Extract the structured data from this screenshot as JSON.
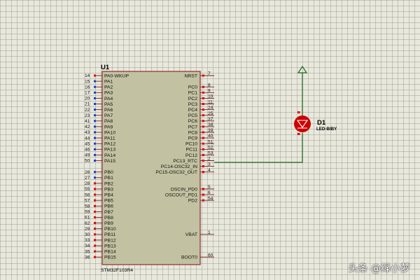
{
  "colors": {
    "chip_fill": "#c2c2a2",
    "chip_border": "#8b2e2e",
    "pin_line": "#7a2020",
    "wire": "#1e6a1e",
    "led_red": "#cc0000",
    "pin_dot_blue": "#1a3cc8",
    "pin_dot_red": "#e00000"
  },
  "chip": {
    "ref": "U1",
    "part": "STM32F103R4",
    "left_pins": [
      {
        "num": "14",
        "label": "PA0-WKUP"
      },
      {
        "num": "15",
        "label": "PA1"
      },
      {
        "num": "16",
        "label": "PA2"
      },
      {
        "num": "17",
        "label": "PA3"
      },
      {
        "num": "20",
        "label": "PA4"
      },
      {
        "num": "21",
        "label": "PA5"
      },
      {
        "num": "22",
        "label": "PA6"
      },
      {
        "num": "23",
        "label": "PA7"
      },
      {
        "num": "41",
        "label": "PA8"
      },
      {
        "num": "42",
        "label": "PA9"
      },
      {
        "num": "43",
        "label": "PA10"
      },
      {
        "num": "44",
        "label": "PA11"
      },
      {
        "num": "45",
        "label": "PA12"
      },
      {
        "num": "46",
        "label": "PA13"
      },
      {
        "num": "49",
        "label": "PA14"
      },
      {
        "num": "50",
        "label": "PA15"
      },
      {
        "num": "26",
        "label": "PB0"
      },
      {
        "num": "27",
        "label": "PB1"
      },
      {
        "num": "28",
        "label": "PB2"
      },
      {
        "num": "55",
        "label": "PB3"
      },
      {
        "num": "56",
        "label": "PB4"
      },
      {
        "num": "57",
        "label": "PB5"
      },
      {
        "num": "58",
        "label": "PB6"
      },
      {
        "num": "59",
        "label": "PB7"
      },
      {
        "num": "61",
        "label": "PB8"
      },
      {
        "num": "62",
        "label": "PB9"
      },
      {
        "num": "29",
        "label": "PB10"
      },
      {
        "num": "30",
        "label": "PB11"
      },
      {
        "num": "33",
        "label": "PB12"
      },
      {
        "num": "34",
        "label": "PB13"
      },
      {
        "num": "35",
        "label": "PB14"
      },
      {
        "num": "36",
        "label": "PB15"
      }
    ],
    "right_pins": [
      {
        "num": "7",
        "label": "NRST"
      },
      {
        "num": "8",
        "label": "PC0"
      },
      {
        "num": "9",
        "label": "PC1"
      },
      {
        "num": "10",
        "label": "PC2"
      },
      {
        "num": "11",
        "label": "PC3"
      },
      {
        "num": "24",
        "label": "PC4"
      },
      {
        "num": "25",
        "label": "PC5"
      },
      {
        "num": "37",
        "label": "PC6"
      },
      {
        "num": "38",
        "label": "PC7"
      },
      {
        "num": "39",
        "label": "PC8"
      },
      {
        "num": "40",
        "label": "PC9"
      },
      {
        "num": "51",
        "label": "PC10"
      },
      {
        "num": "52",
        "label": "PC11"
      },
      {
        "num": "53",
        "label": "PC12"
      },
      {
        "num": "2",
        "label": "PC13_RTC"
      },
      {
        "num": "3",
        "label": "PC14-OSC32_IN"
      },
      {
        "num": "4",
        "label": "PC15-OSC32_OUT"
      },
      {
        "num": "5",
        "label": "OSCIN_PD0"
      },
      {
        "num": "6",
        "label": "OSCOUT_PD1"
      },
      {
        "num": "54",
        "label": "PD2"
      },
      {
        "num": "1",
        "label": "VBAT"
      },
      {
        "num": "60",
        "label": "BOOT0"
      }
    ]
  },
  "led": {
    "ref": "D1",
    "value": "LED-BIBY"
  },
  "watermark": "头条 @绿小萝"
}
